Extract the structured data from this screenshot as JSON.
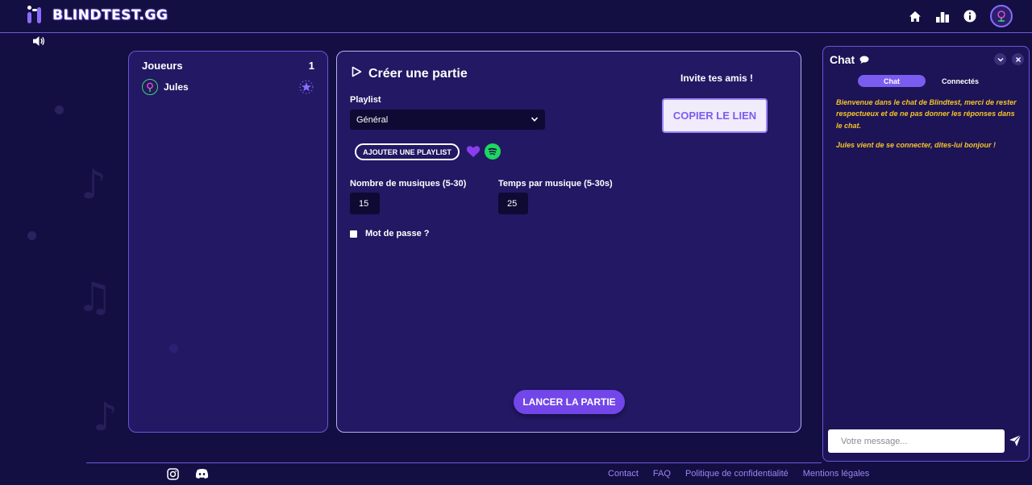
{
  "header": {
    "logo_text": "BLINDTEST.GG",
    "nav_icons": [
      "home-icon",
      "leaderboard-icon",
      "info-icon",
      "avatar"
    ]
  },
  "players": {
    "title": "Joueurs",
    "count": "1",
    "items": [
      {
        "name": "Jules",
        "badge_icon": "host-star-icon"
      }
    ]
  },
  "create": {
    "title": "Créer une partie",
    "playlist_label": "Playlist",
    "playlist_value": "Général",
    "add_playlist_label": "AJOUTER UNE PLAYLIST",
    "music_count_label": "Nombre de musiques (5-30)",
    "music_count_value": "15",
    "time_label": "Temps par musique (5-30s)",
    "time_value": "25",
    "pass_word_label": "Mot de passe ?",
    "invite_title": "Invite tes amis !",
    "copy_link_label": "COPIER LE LIEN",
    "launch_label": "LANCER LA PARTIE"
  },
  "chat": {
    "title": "Chat",
    "tab_chat": "Chat",
    "tab_connected": "Connectés",
    "messages": [
      "Bienvenue dans le chat de Blindtest, merci de rester respectueux et de ne pas donner les réponses dans le chat.",
      "Jules vient de se connecter, dites-lui bonjour !"
    ],
    "input_placeholder": "Votre message..."
  },
  "footer": {
    "links": [
      "Contact",
      "FAQ",
      "Politique de confidentialité",
      "Mentions légales"
    ],
    "social_icons": [
      "instagram-icon",
      "discord-icon"
    ]
  },
  "colors": {
    "background": "#140f42",
    "accent": "#7a5cf0",
    "chat_text": "#f7c326",
    "spotify": "#1ed760"
  }
}
